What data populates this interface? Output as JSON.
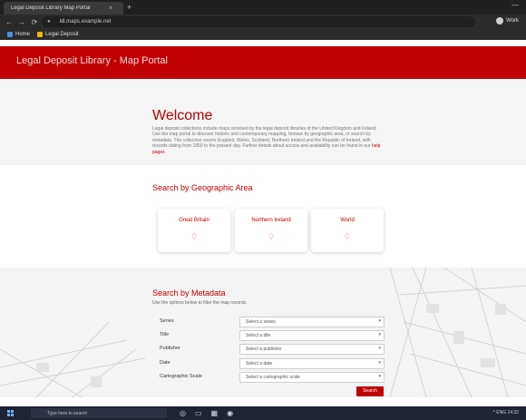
{
  "browser": {
    "tab_title": "Legal Deposit Library Map Portal",
    "tab_close": "×",
    "new_tab": "+",
    "window_controls": "—",
    "back": "←",
    "forward": "→",
    "reload": "⟳",
    "url": "ldl.maps.example.net",
    "profile_label": "Work",
    "bookmarks": [
      {
        "label": "Home",
        "icon": "folder-icon",
        "color": "#4a90e2"
      },
      {
        "label": "Legal Deposit",
        "icon": "bookmark-icon",
        "color": "#f0b400"
      }
    ]
  },
  "site": {
    "title": "Legal Deposit Library - Map Portal",
    "accent": "#c00000"
  },
  "welcome": {
    "heading": "Welcome",
    "body": "Legal deposit collections include maps received by the legal deposit libraries of the United Kingdom and Ireland. Use the map portal to discover historic and contemporary mapping, browse by geographic area, or search by metadata. The collection covers England, Wales, Scotland, Northern Ireland and the Republic of Ireland, with records dating from 1850 to the present day. Further details about access and availability can be found in our",
    "link": "help pages"
  },
  "geo": {
    "title": "Search by Geographic Area",
    "cards": [
      {
        "label": "Great Britain",
        "icon": "pin-icon"
      },
      {
        "label": "Northern Ireland",
        "icon": "pin-icon"
      },
      {
        "label": "World",
        "icon": "pin-icon"
      }
    ]
  },
  "meta": {
    "title": "Search by Metadata",
    "subtitle": "Use the options below to filter the map records.",
    "filters": [
      {
        "label": "Series",
        "value": "Select a series"
      },
      {
        "label": "Title",
        "value": "Select a title"
      },
      {
        "label": "Publisher",
        "value": "Select a publisher"
      },
      {
        "label": "Date",
        "value": "Select a date"
      },
      {
        "label": "Cartographic Scale",
        "value": "Select a cartographic scale"
      }
    ],
    "caret": "▾",
    "search_label": "Search"
  },
  "taskbar": {
    "search_placeholder": "Type here to search",
    "apps": [
      "◎",
      "▭",
      "▦",
      "◉"
    ],
    "tray": "^ ENG 14:32"
  }
}
